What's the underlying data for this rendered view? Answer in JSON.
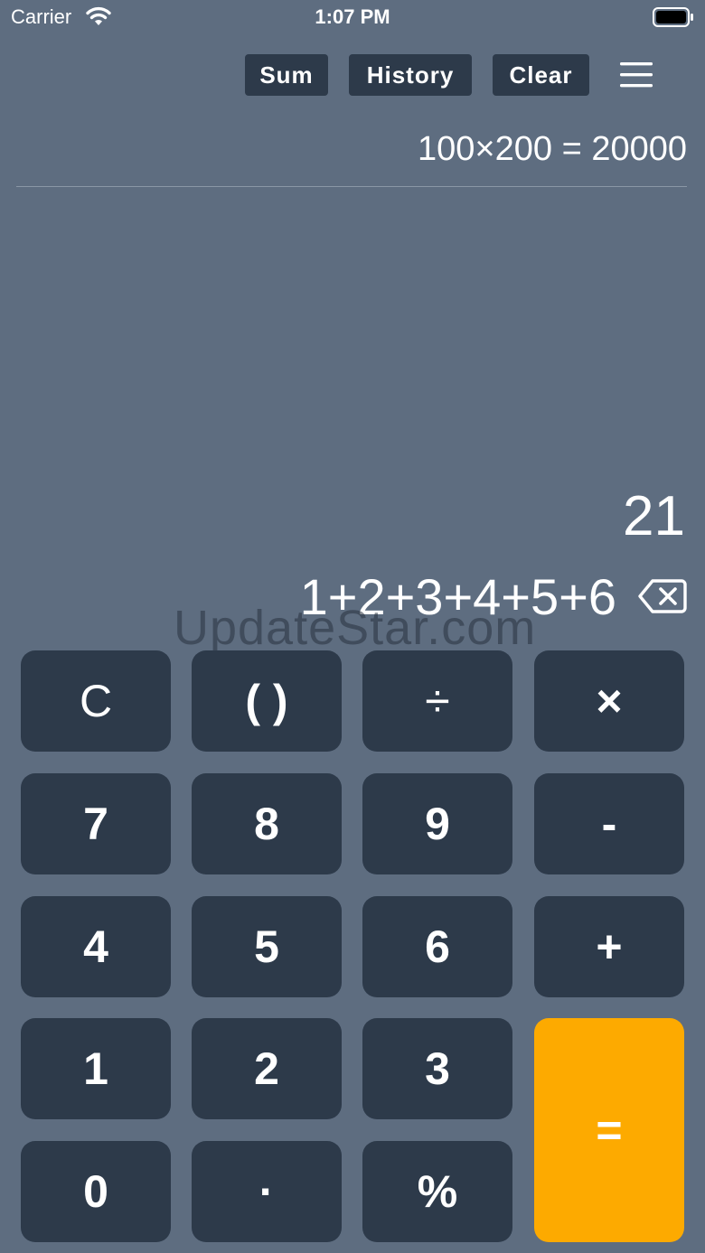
{
  "status_bar": {
    "carrier": "Carrier",
    "time": "1:07 PM"
  },
  "toolbar": {
    "sum_label": "Sum",
    "history_label": "History",
    "clear_label": "Clear"
  },
  "history": {
    "last_entry": "100×200 = 20000"
  },
  "display": {
    "result": "21",
    "expression": "1+2+3+4+5+6"
  },
  "watermark": "UpdateStar.com",
  "keypad": {
    "clear": "C",
    "parentheses": "( )",
    "divide": "÷",
    "multiply": "×",
    "seven": "7",
    "eight": "8",
    "nine": "9",
    "minus": "-",
    "four": "4",
    "five": "5",
    "six": "6",
    "plus": "+",
    "one": "1",
    "two": "2",
    "three": "3",
    "equals": "=",
    "zero": "0",
    "decimal": "·",
    "percent": "%"
  },
  "colors": {
    "background": "#5e6d80",
    "key": "#2d3a4a",
    "equals_key": "#fdaa00",
    "text": "#ffffff"
  },
  "icons": {
    "wifi": "wifi-icon",
    "battery": "battery-icon",
    "menu": "hamburger-menu-icon",
    "backspace": "backspace-icon"
  }
}
